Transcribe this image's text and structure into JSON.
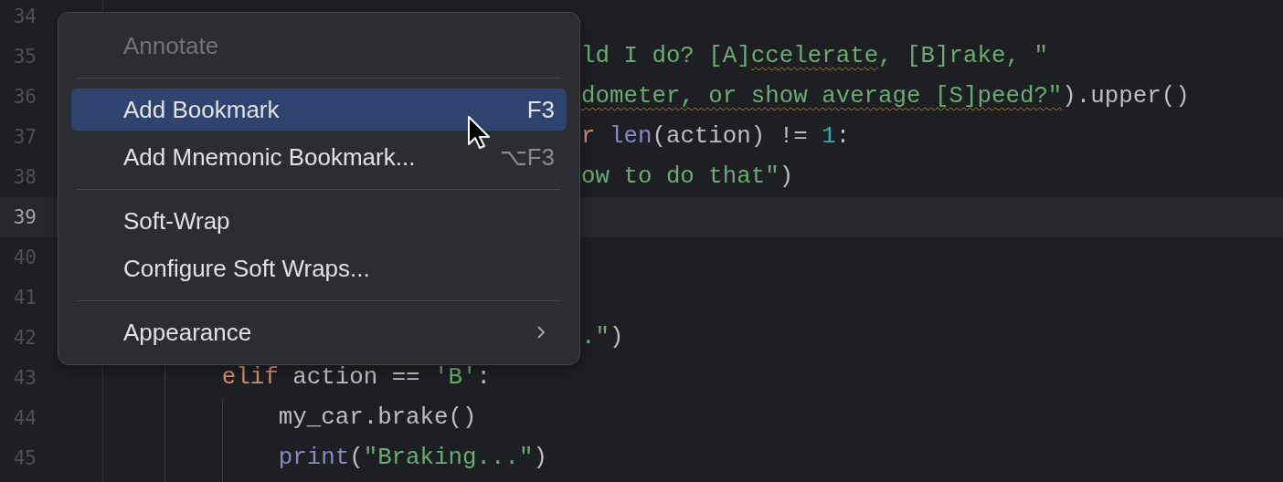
{
  "editor": {
    "lines": [
      {
        "number": "34",
        "current": false
      },
      {
        "number": "35",
        "current": false,
        "hidden_start": true,
        "tokens": [
          {
            "text": "ld I do? [A]",
            "kind": "string",
            "typo": false
          },
          {
            "text": "ccelerate",
            "kind": "string",
            "typo": true
          },
          {
            "text": ", [B]rake, \"",
            "kind": "string",
            "typo": false
          }
        ]
      },
      {
        "number": "36",
        "current": false,
        "hidden_start": true,
        "tokens": [
          {
            "text": "dometer, or show average [S]peed?\"",
            "kind": "string",
            "typo": true
          },
          {
            "text": ").upper()",
            "kind": "plain",
            "typo": false
          }
        ]
      },
      {
        "number": "37",
        "current": false,
        "hidden_start": true,
        "tokens": [
          {
            "text": "r ",
            "kind": "keyword",
            "typo": false
          },
          {
            "text": "len",
            "kind": "builtin",
            "typo": false
          },
          {
            "text": "(action) != ",
            "kind": "plain",
            "typo": false
          },
          {
            "text": "1",
            "kind": "number",
            "typo": false
          },
          {
            "text": ":",
            "kind": "plain",
            "typo": false
          }
        ]
      },
      {
        "number": "38",
        "current": false,
        "hidden_start": true,
        "tokens": [
          {
            "text": "ow to do that\"",
            "kind": "string",
            "typo": false
          },
          {
            "text": ")",
            "kind": "plain",
            "typo": false
          }
        ]
      },
      {
        "number": "39",
        "current": true
      },
      {
        "number": "40",
        "current": false
      },
      {
        "number": "41",
        "current": false
      },
      {
        "number": "42",
        "current": false,
        "hidden_start": true,
        "tokens": [
          {
            "text": ".\"",
            "kind": "string",
            "typo": false
          },
          {
            "text": ")",
            "kind": "plain",
            "typo": false
          }
        ]
      },
      {
        "number": "43",
        "current": false,
        "hidden_start": false,
        "tokens": [
          {
            "text": "        elif",
            "kind": "keyword",
            "typo": false
          },
          {
            "text": " action == ",
            "kind": "plain",
            "typo": false
          },
          {
            "text": "'B'",
            "kind": "string",
            "typo": false
          },
          {
            "text": ":",
            "kind": "plain",
            "typo": false
          }
        ]
      },
      {
        "number": "44",
        "current": false,
        "hidden_start": false,
        "tokens": [
          {
            "text": "            my_car.brake()",
            "kind": "plain",
            "typo": false
          }
        ]
      },
      {
        "number": "45",
        "current": false,
        "hidden_start": false,
        "tokens": [
          {
            "text": "            print",
            "kind": "builtin",
            "typo": false
          },
          {
            "text": "(",
            "kind": "plain",
            "typo": false
          },
          {
            "text": "\"Braking...\"",
            "kind": "string",
            "typo": false
          },
          {
            "text": ")",
            "kind": "plain",
            "typo": false
          }
        ]
      }
    ]
  },
  "context_menu": {
    "items": [
      {
        "kind": "item",
        "label": "Annotate",
        "disabled": true,
        "selected": false,
        "has_submenu": false
      },
      {
        "kind": "separator"
      },
      {
        "kind": "item",
        "label": "Add Bookmark",
        "shortcut": "F3",
        "disabled": false,
        "selected": true,
        "has_submenu": false
      },
      {
        "kind": "item",
        "label": "Add Mnemonic Bookmark...",
        "shortcut": "⌥F3",
        "disabled": false,
        "selected": false,
        "has_submenu": false
      },
      {
        "kind": "separator"
      },
      {
        "kind": "item",
        "label": "Soft-Wrap",
        "disabled": false,
        "selected": false,
        "has_submenu": false
      },
      {
        "kind": "item",
        "label": "Configure Soft Wraps...",
        "disabled": false,
        "selected": false,
        "has_submenu": false
      },
      {
        "kind": "separator"
      },
      {
        "kind": "item",
        "label": "Appearance",
        "disabled": false,
        "selected": false,
        "has_submenu": true
      }
    ]
  }
}
